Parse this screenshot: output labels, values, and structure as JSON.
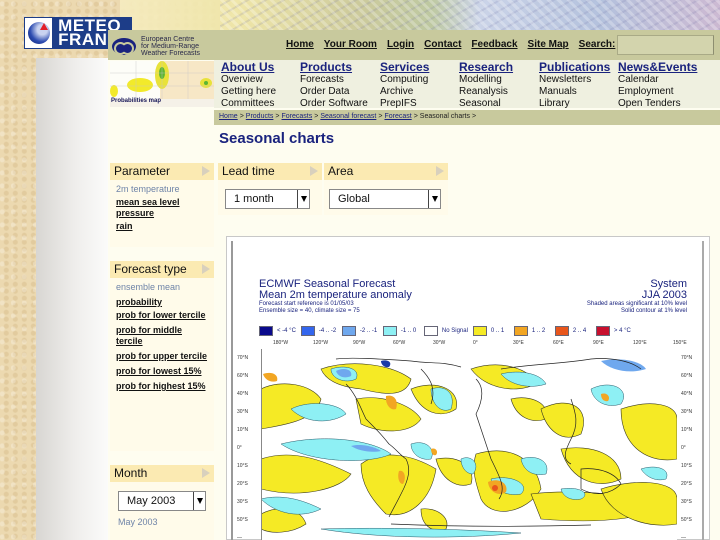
{
  "slide": {
    "logo_text_line1": "METEO",
    "logo_text_line2": "FRANCE"
  },
  "site": {
    "org_name_line1": "European Centre",
    "org_name_line2": "for Medium-Range",
    "org_name_line3": "Weather Forecasts",
    "thumbnail_caption": "Probabilities map"
  },
  "topnav": {
    "items": [
      "Home",
      "Your Room",
      "Login",
      "Contact",
      "Feedback",
      "Site Map",
      "Search:"
    ],
    "search_value": ""
  },
  "menu": [
    {
      "head": "About Us",
      "items": [
        "Overview",
        "Getting here",
        "Committees"
      ]
    },
    {
      "head": "Products",
      "items": [
        "Forecasts",
        "Order Data",
        "Order Software"
      ]
    },
    {
      "head": "Services",
      "items": [
        "Computing",
        "Archive",
        "PrepIFS"
      ]
    },
    {
      "head": "Research",
      "items": [
        "Modelling",
        "Reanalysis",
        "Seasonal"
      ]
    },
    {
      "head": "Publications",
      "items": [
        "Newsletters",
        "Manuals",
        "Library"
      ]
    },
    {
      "head": "News&Events",
      "items": [
        "Calendar",
        "Employment",
        "Open Tenders"
      ]
    }
  ],
  "breadcrumb": {
    "links": [
      "Home",
      "Products",
      "Forecasts",
      "Seasonal forecast",
      "Forecast"
    ],
    "current": "Seasonal charts",
    "separator": ">"
  },
  "page_title": "Seasonal charts",
  "parameter_panel": {
    "title": "Parameter",
    "options": [
      {
        "label": "2m temperature",
        "active": true
      },
      {
        "label": "mean sea level pressure",
        "active": false
      },
      {
        "label": "rain",
        "active": false
      }
    ]
  },
  "lead_time_panel": {
    "title": "Lead time",
    "selected": "1 month"
  },
  "area_panel": {
    "title": "Area",
    "selected": "Global"
  },
  "forecast_type_panel": {
    "title": "Forecast type",
    "options": [
      {
        "label": "ensemble mean",
        "active": true
      },
      {
        "label": "probability",
        "active": false
      },
      {
        "label": "prob for lower tercile",
        "active": false
      },
      {
        "label": "prob for middle tercile",
        "active": false
      },
      {
        "label": "prob for upper tercile",
        "active": false
      },
      {
        "label": "prob for lowest 15%",
        "active": false
      },
      {
        "label": "prob for highest 15%",
        "active": false
      }
    ]
  },
  "month_panel": {
    "title": "Month",
    "selected": "May 2003",
    "current_label": "May 2003"
  },
  "chart": {
    "title_line1": "ECMWF Seasonal Forecast",
    "title_line2": "Mean 2m temperature anomaly",
    "info_line1": "Forecast start reference is 01/05/03",
    "info_line2": "Ensemble size = 40, climate size = 75",
    "system_label": "System",
    "period_label": "JJA 2003",
    "note_line1": "Shaded areas significant at 10% level",
    "note_line2": "Solid contour at 1% level",
    "legend": [
      {
        "label": "< -4 °C",
        "color": "#0a0a8c"
      },
      {
        "label": "-4 .. -2",
        "color": "#3366ee"
      },
      {
        "label": "-2 .. -1",
        "color": "#6fa8ee"
      },
      {
        "label": "-1 .. 0",
        "color": "#8ef0f4"
      },
      {
        "label": "No Signal",
        "color": "#ffffff"
      },
      {
        "label": "0 .. 1",
        "color": "#f5ea25"
      },
      {
        "label": "1 .. 2",
        "color": "#f2a623"
      },
      {
        "label": "2 .. 4",
        "color": "#e8561c"
      },
      {
        "label": "> 4 °C",
        "color": "#c8102e"
      }
    ],
    "lon_labels": [
      "180°W",
      "120°W",
      "90°W",
      "60°W",
      "30°W",
      "0°",
      "30°E",
      "60°E",
      "90°E",
      "120°E",
      "150°E"
    ],
    "lat_labels": [
      "70°N",
      "60°N",
      "40°N",
      "30°N",
      "10°N",
      "0°",
      "10°S",
      "20°S",
      "30°S",
      "50°S",
      "—"
    ]
  }
}
